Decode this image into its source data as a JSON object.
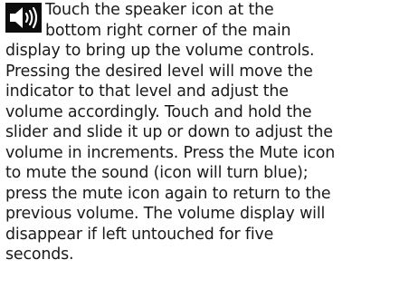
{
  "icon": "speaker-volume-icon",
  "paragraph": {
    "lines": [
      "Touch the speaker icon at the",
      "bottom right corner of the main",
      "display to bring up the volume controls.",
      "Pressing the desired level will move the",
      "indicator to that level and adjust the",
      "volume accordingly. Touch and hold the",
      "slider and slide it up or down to adjust the",
      "volume in increments. Press the Mute icon",
      "to mute the sound (icon will turn blue);",
      "press the mute icon again to return to the",
      "previous volume. The volume display will",
      "disappear if left untouched for five",
      "seconds."
    ]
  }
}
